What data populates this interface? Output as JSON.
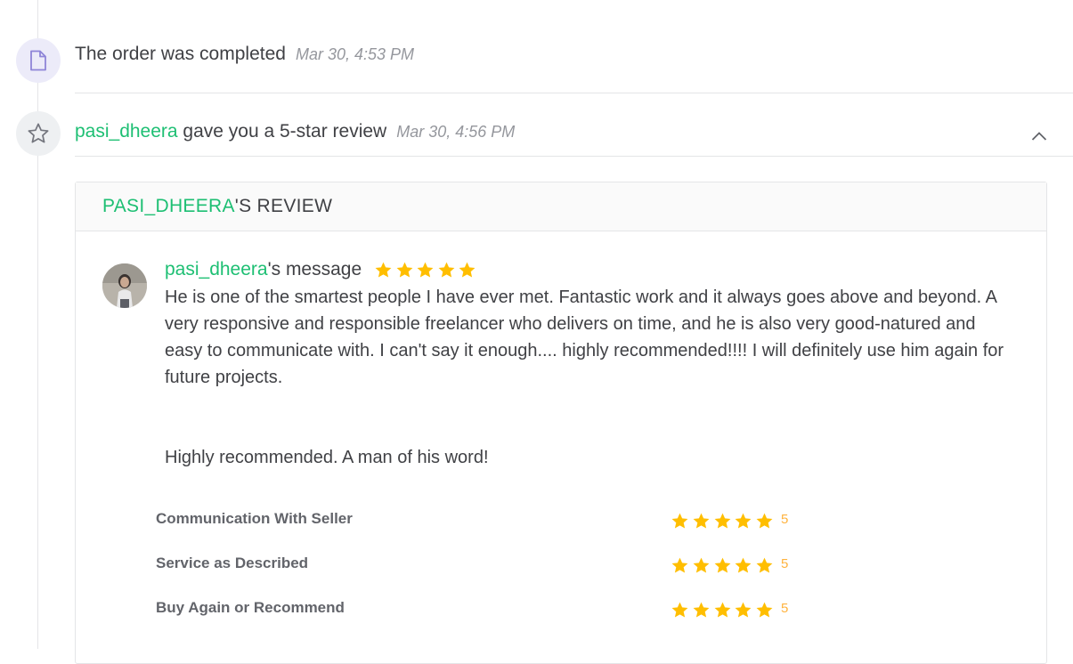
{
  "colors": {
    "accent": "#1dbf73",
    "star": "#ffb33e",
    "text": "#404145",
    "muted": "#95979d"
  },
  "events": [
    {
      "icon": "document-icon",
      "title": "The order was completed",
      "time": "Mar 30, 4:53 PM"
    },
    {
      "icon": "star-outline-icon",
      "username": "pasi_dheera",
      "title": " gave you a 5-star review",
      "time": "Mar 30, 4:56 PM",
      "toggle_icon": "chevron-up-icon"
    }
  ],
  "review": {
    "header_username": "PASI_DHEERA",
    "header_suffix": "'S REVIEW",
    "reviewer": "pasi_dheera",
    "message_suffix": "'s message",
    "overall_stars": 5,
    "message_paragraphs": [
      "He is one of the smartest people I have ever met. Fantastic work and it always goes above and beyond. A very responsive and responsible freelancer who delivers on time, and he is also very good-natured and easy to communicate with. I can't say it enough.... highly recommended!!!! I will definitely use him again for future projects.",
      "Highly recommended. A man of his word!"
    ],
    "ratings": [
      {
        "label": "Communication With Seller",
        "stars": 5,
        "value": "5"
      },
      {
        "label": "Service as Described",
        "stars": 5,
        "value": "5"
      },
      {
        "label": "Buy Again or Recommend",
        "stars": 5,
        "value": "5"
      }
    ]
  }
}
